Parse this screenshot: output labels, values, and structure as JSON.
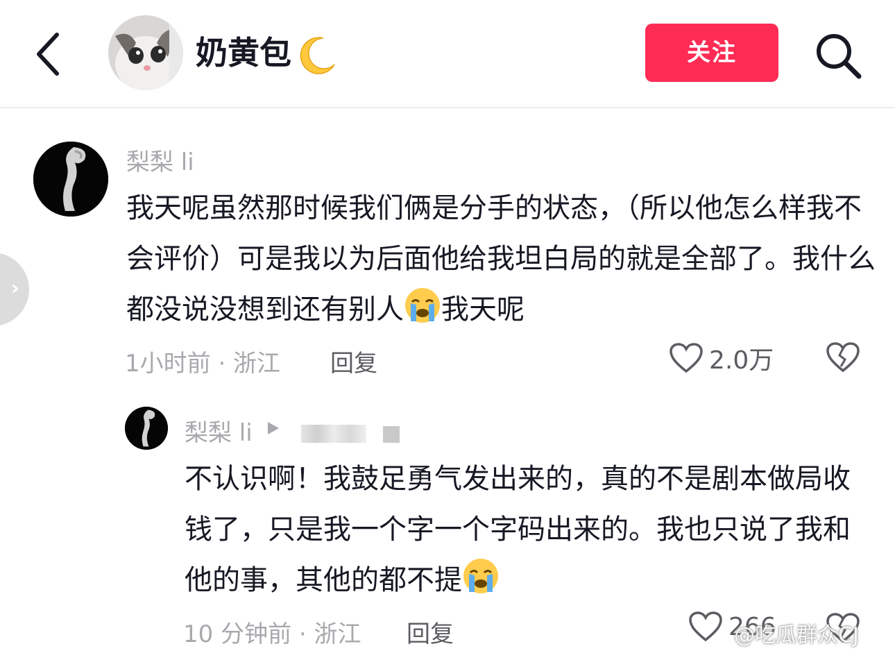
{
  "header": {
    "title": "奶黄包",
    "follow_label": "关注"
  },
  "comments": [
    {
      "username": "梨梨 li",
      "text": "我天呢虽然那时候我们俩是分手的状态，（所以他怎么样我不会评价）可是我以为后面他给我坦白局的就是全部了。我什么都没说没想到还有别人",
      "text_after_emoji": "我天呢",
      "time_location": "1小时前 · 浙江",
      "reply_label": "回复",
      "likes": "2.0万"
    },
    {
      "username": "梨梨 li",
      "text": "不认识啊！我鼓足勇气发出来的，真的不是剧本做局收钱了，只是我一个字一个字码出来的。我也只说了我和他的事，其他的都不提",
      "time_location": "10 分钟前 · 浙江",
      "reply_label": "回复",
      "likes": "266"
    }
  ],
  "watermark": "@吃瓜群众CJ",
  "icons": {
    "back": "chevron-left-icon",
    "search": "search-icon",
    "moon": "crescent-moon-emoji",
    "crying": "loudly-crying-emoji",
    "like": "heart-outline-icon",
    "dislike": "broken-heart-icon",
    "reply_arrow": "play-triangle-icon",
    "side": "chevron-right-icon"
  },
  "colors": {
    "follow_button": "#fe2c55",
    "meta_text": "#a8a9ad",
    "body_text": "#161823"
  }
}
